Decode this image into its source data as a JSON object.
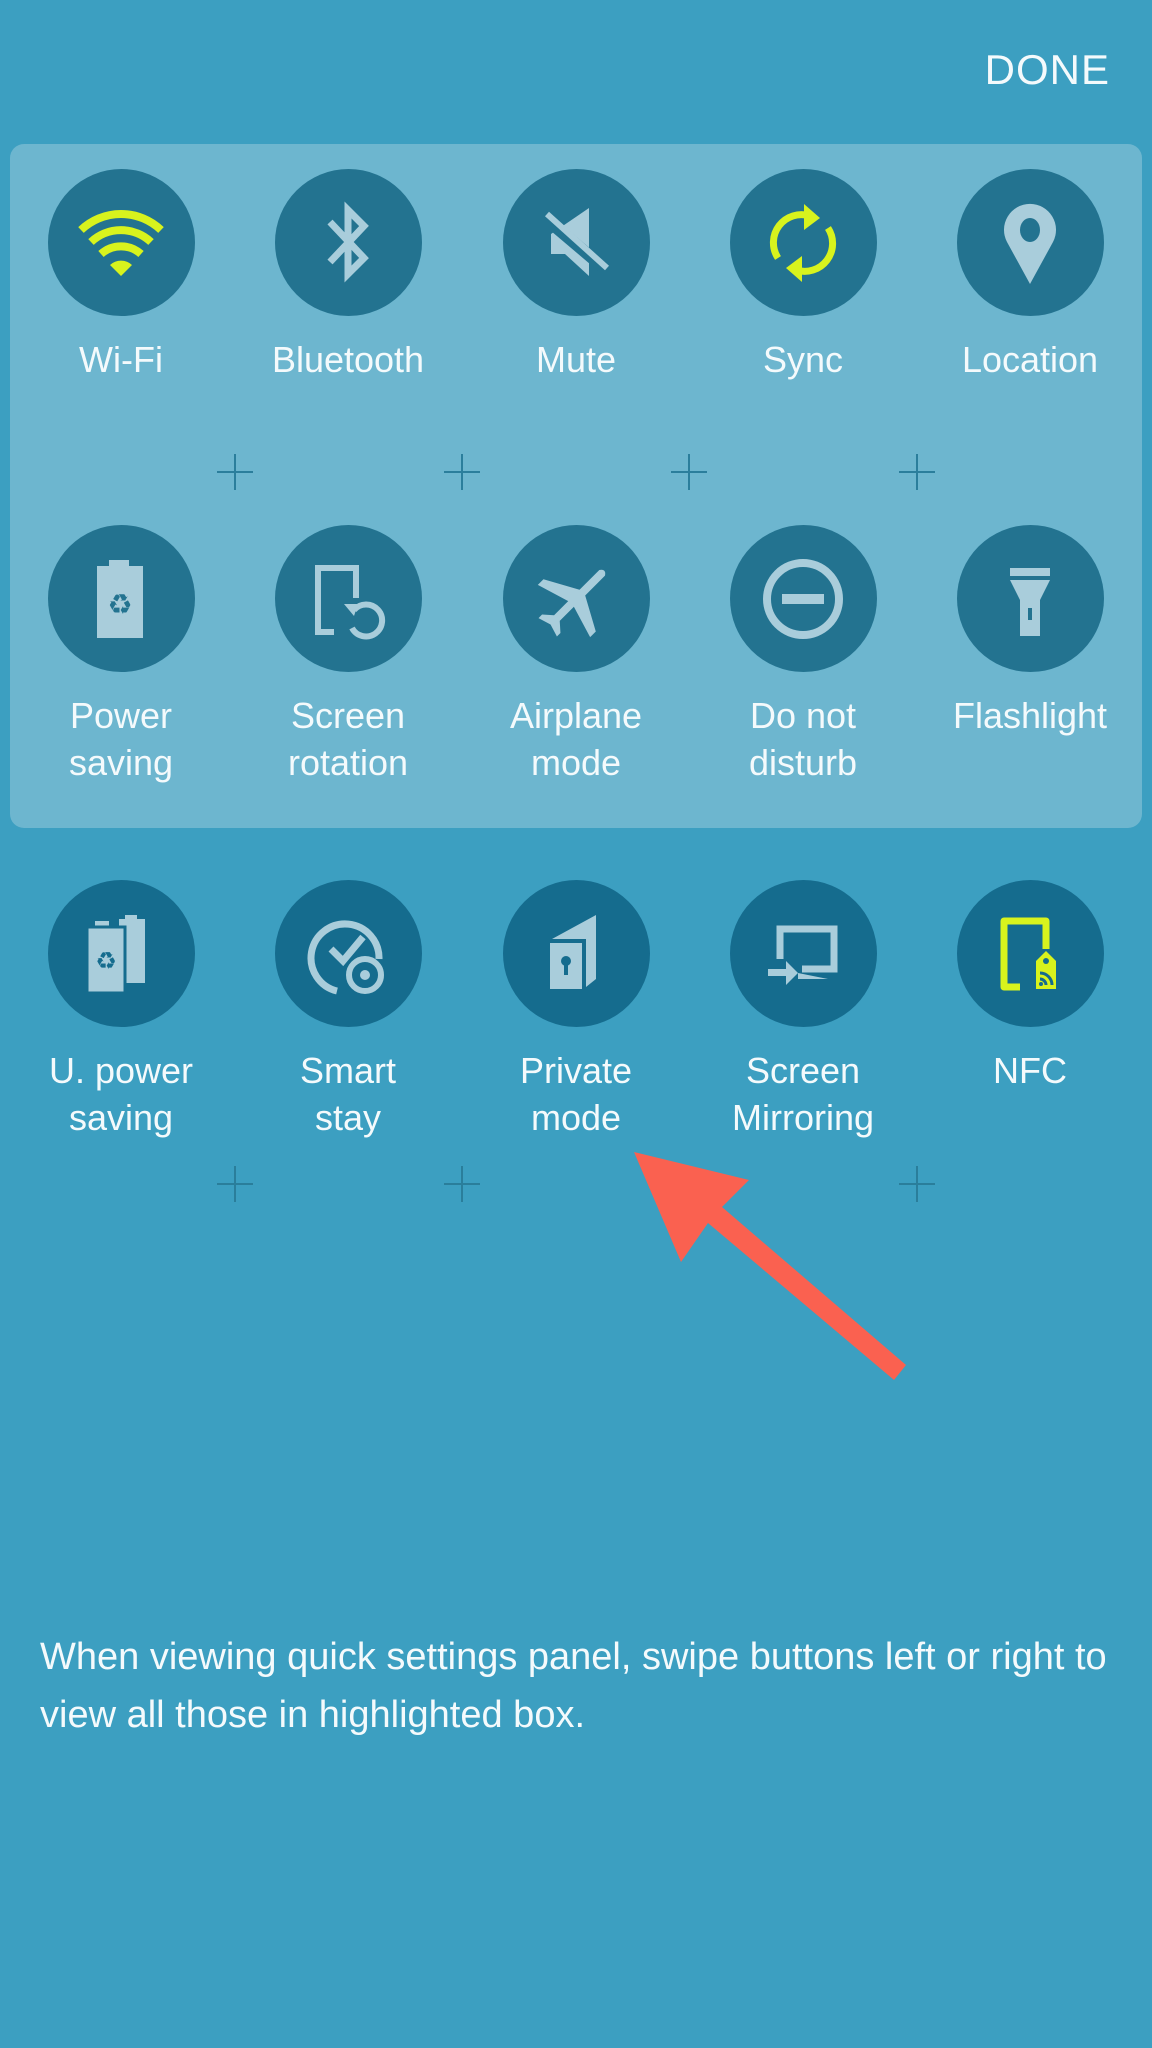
{
  "header": {
    "done_label": "DONE"
  },
  "colors": {
    "background": "#3c9fc1",
    "highlight_panel": "#6db6cf",
    "tile_circle_active_row": "#237390",
    "tile_circle_inactive_row": "#156c8e",
    "icon_on": "#d8f31d",
    "icon_off": "#a9cddb",
    "annotation_arrow": "#fa6150"
  },
  "highlighted_tiles": [
    {
      "label": "Wi-Fi",
      "icon": "wifi-icon",
      "state": "on"
    },
    {
      "label": "Bluetooth",
      "icon": "bluetooth-icon",
      "state": "off"
    },
    {
      "label": "Mute",
      "icon": "mute-icon",
      "state": "off"
    },
    {
      "label": "Sync",
      "icon": "sync-icon",
      "state": "on"
    },
    {
      "label": "Location",
      "icon": "location-icon",
      "state": "off"
    },
    {
      "label": "Power\nsaving",
      "icon": "power-saving-icon",
      "state": "off"
    },
    {
      "label": "Screen\nrotation",
      "icon": "screen-rotation-icon",
      "state": "off"
    },
    {
      "label": "Airplane\nmode",
      "icon": "airplane-icon",
      "state": "off"
    },
    {
      "label": "Do not\ndisturb",
      "icon": "do-not-disturb-icon",
      "state": "off"
    },
    {
      "label": "Flashlight",
      "icon": "flashlight-icon",
      "state": "off"
    }
  ],
  "available_tiles": [
    {
      "label": "U. power\nsaving",
      "icon": "ultra-power-saving-icon",
      "state": "off"
    },
    {
      "label": "Smart\nstay",
      "icon": "smart-stay-icon",
      "state": "off"
    },
    {
      "label": "Private\nmode",
      "icon": "private-mode-icon",
      "state": "off"
    },
    {
      "label": "Screen\nMirroring",
      "icon": "screen-mirroring-icon",
      "state": "off"
    },
    {
      "label": "NFC",
      "icon": "nfc-icon",
      "state": "on"
    }
  ],
  "hint_text": "When viewing quick settings panel, swipe buttons left or right to view all those in highlighted box."
}
